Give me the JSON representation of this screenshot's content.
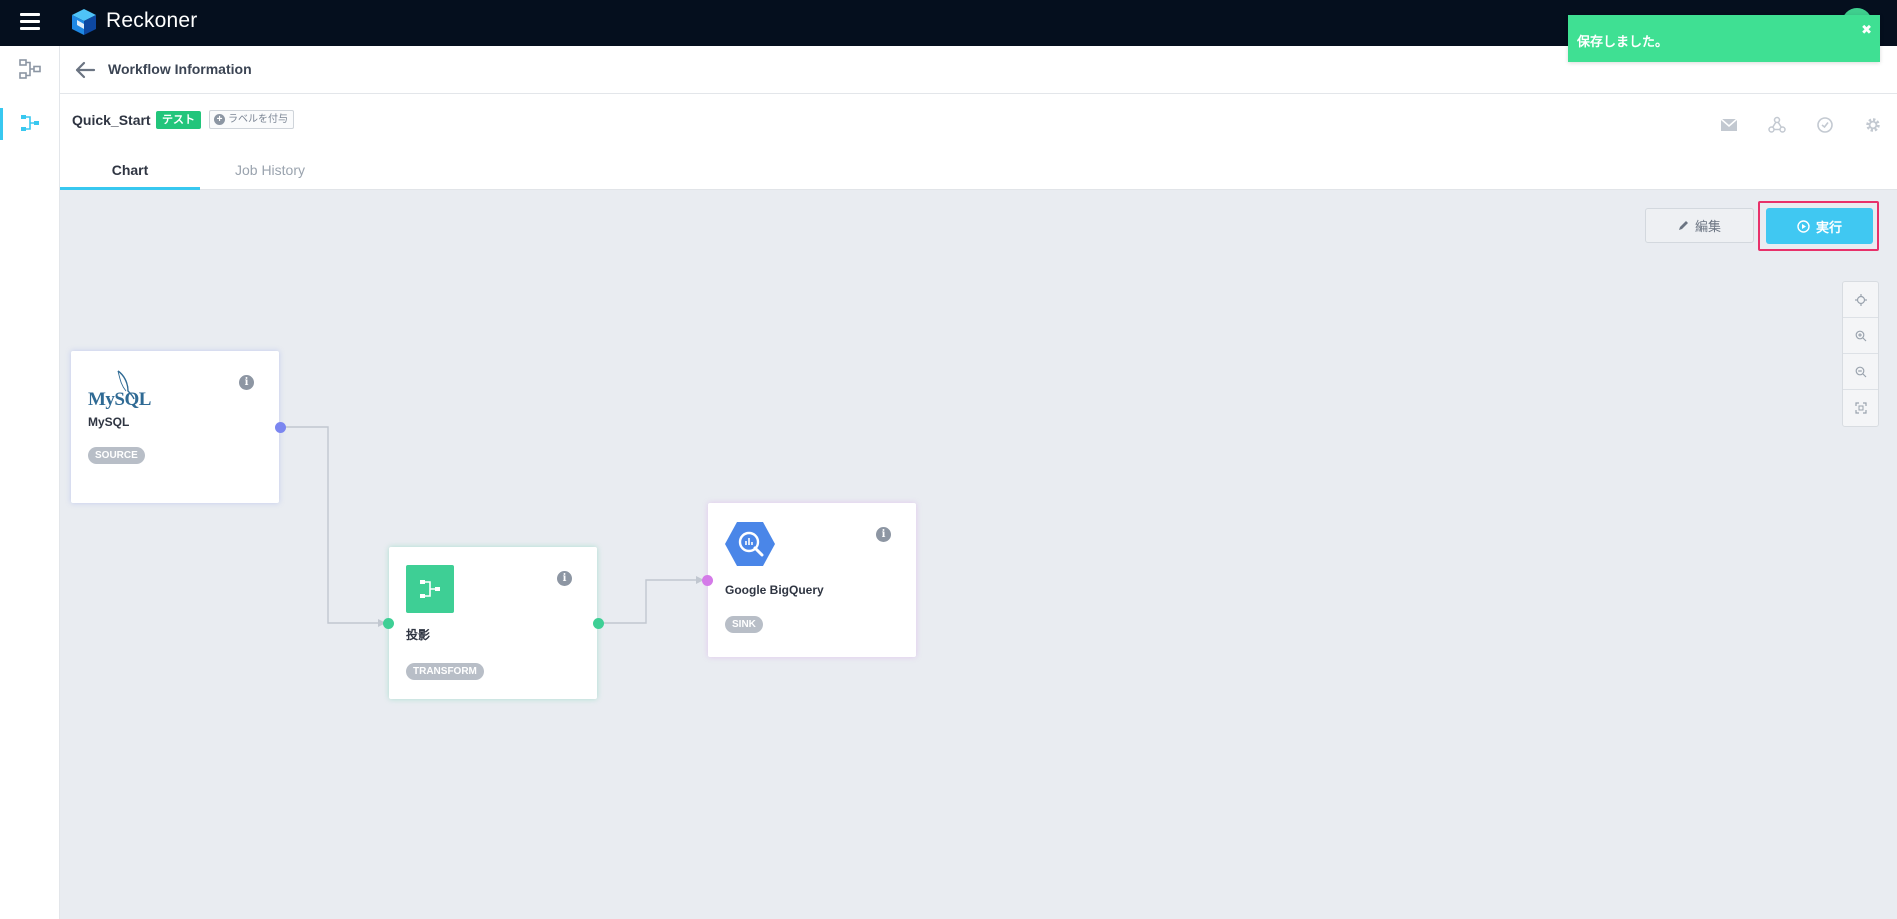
{
  "app": {
    "brand": "Reckoner"
  },
  "header": {
    "back_label": "",
    "page_title": "Workflow Information"
  },
  "workflow": {
    "name": "Quick_Start",
    "badge": "テスト",
    "add_label": "ラベルを付与"
  },
  "tabs": [
    {
      "label": "Chart",
      "active": true
    },
    {
      "label": "Job History",
      "active": false
    }
  ],
  "toolbar": {
    "edit_label": "編集",
    "run_label": "実行"
  },
  "nodes": {
    "source": {
      "logo_text": "MySQL",
      "label": "MySQL",
      "type": "SOURCE"
    },
    "transform": {
      "label": "投影",
      "type": "TRANSFORM"
    },
    "sink": {
      "label": "Google BigQuery",
      "type": "SINK"
    }
  },
  "toast": {
    "message": "保存しました。",
    "close": "✖"
  },
  "colors": {
    "accent": "#40c8f2",
    "topbar": "#050f1e",
    "badge_test": "#22c57b",
    "transform": "#3ecf95",
    "source_port": "#7b86f0",
    "sink_port": "#d47ae8",
    "toast": "#3fe093",
    "highlight": "#e8316a"
  },
  "icons": {
    "rail": [
      "workflow-icon",
      "workflow-icon"
    ],
    "header": [
      "mail-icon",
      "share-icon",
      "clock-icon",
      "gear-icon"
    ],
    "zoom": [
      "target-icon",
      "zoom-in-icon",
      "zoom-out-icon",
      "fit-screen-icon"
    ]
  }
}
